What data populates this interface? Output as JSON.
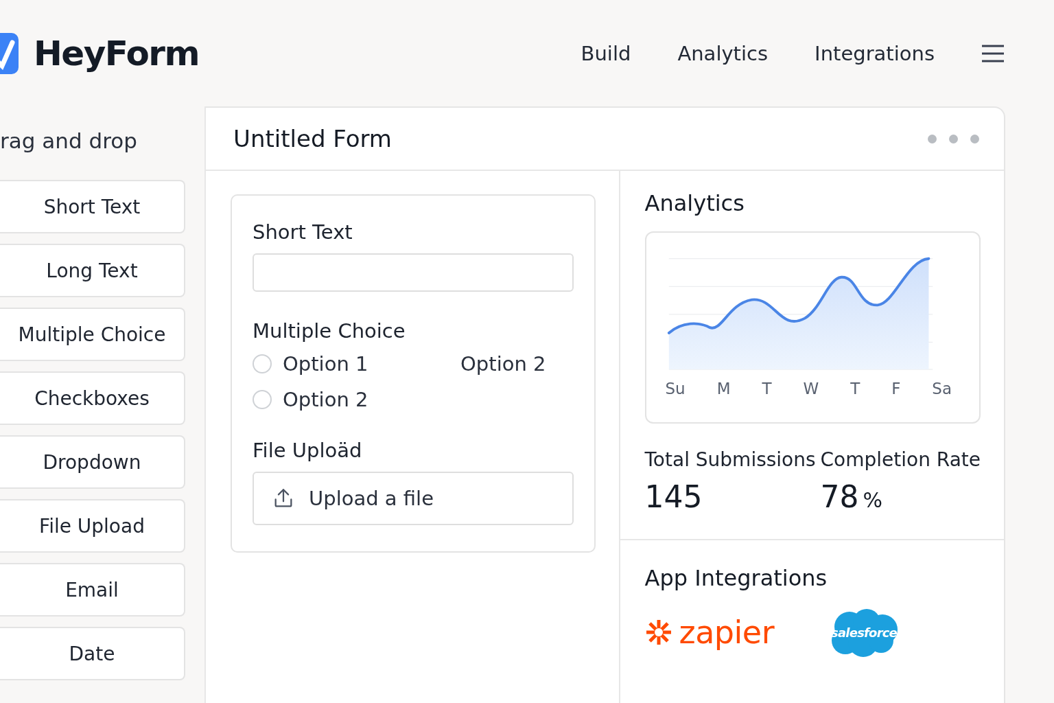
{
  "brand": {
    "name": "HeyForm"
  },
  "nav": [
    {
      "label": "Build"
    },
    {
      "label": "Analytics"
    },
    {
      "label": "Integrations"
    }
  ],
  "sidebar": {
    "title": "rag and drop",
    "items": [
      "Short Text",
      "Long Text",
      "Multiple Choice",
      "Checkboxes",
      "Dropdown",
      "File Upload",
      "Email",
      "Date"
    ]
  },
  "form": {
    "title": "Untitled Form",
    "fields": [
      {
        "kind": "text",
        "label": "Short Text"
      },
      {
        "kind": "choice",
        "label": "Multiple Choice",
        "options": [
          {
            "label": "Option 1",
            "selected": false
          },
          {
            "label": "Option 2",
            "selected": false
          }
        ],
        "aside": "Option 2"
      },
      {
        "kind": "upload",
        "label": "File Uploäd",
        "button": "Upload a file"
      }
    ]
  },
  "analytics": {
    "title": "Analytics",
    "days": [
      "Su",
      "M",
      "T",
      "W",
      "T",
      "F",
      "Sa"
    ],
    "stats": [
      {
        "label": "Total Submissions",
        "value": "145"
      },
      {
        "label": "Completion Rate",
        "value": "78",
        "unit": "%"
      }
    ]
  },
  "integrations": {
    "title": "App Integrations",
    "apps": [
      {
        "kind": "zapier",
        "name": "zapier"
      },
      {
        "kind": "salesforce",
        "name": "salesforce"
      }
    ]
  }
}
